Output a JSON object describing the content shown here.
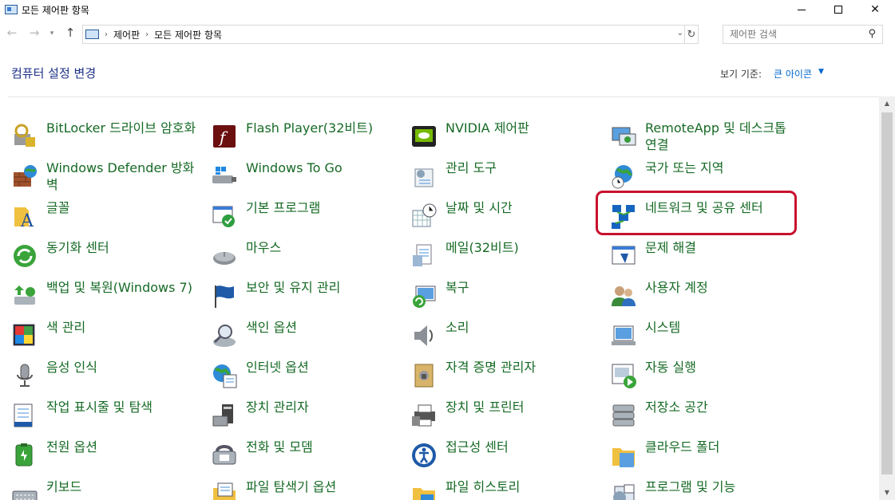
{
  "window": {
    "title": "모든 제어판 항목"
  },
  "address": {
    "crumbs": [
      "제어판",
      "모든 제어판 항목"
    ],
    "search_placeholder": "제어판 검색"
  },
  "header": {
    "title": "컴퓨터 설정 변경",
    "view_by_label": "보기 기준:",
    "view_by_value": "큰 아이콘"
  },
  "items": [
    {
      "label": "BitLocker 드라이브 암호화",
      "icon": "bitlocker-icon"
    },
    {
      "label": "Flash Player(32비트)",
      "icon": "flash-player-icon"
    },
    {
      "label": "NVIDIA 제어판",
      "icon": "nvidia-icon"
    },
    {
      "label": "RemoteApp 및 데스크톱 연결",
      "icon": "remoteapp-icon"
    },
    {
      "label": "Windows Defender 방화벽",
      "icon": "firewall-icon"
    },
    {
      "label": "Windows To Go",
      "icon": "windows-to-go-icon"
    },
    {
      "label": "관리 도구",
      "icon": "admin-tools-icon"
    },
    {
      "label": "국가 또는 지역",
      "icon": "region-icon"
    },
    {
      "label": "글꼴",
      "icon": "fonts-icon"
    },
    {
      "label": "기본 프로그램",
      "icon": "default-programs-icon"
    },
    {
      "label": "날짜 및 시간",
      "icon": "date-time-icon"
    },
    {
      "label": "네트워크 및 공유 센터",
      "icon": "network-icon"
    },
    {
      "label": "동기화 센터",
      "icon": "sync-center-icon"
    },
    {
      "label": "마우스",
      "icon": "mouse-icon"
    },
    {
      "label": "메일(32비트)",
      "icon": "mail-icon"
    },
    {
      "label": "문제 해결",
      "icon": "troubleshooting-icon"
    },
    {
      "label": "백업 및 복원(Windows 7)",
      "icon": "backup-icon"
    },
    {
      "label": "보안 및 유지 관리",
      "icon": "security-flag-icon"
    },
    {
      "label": "복구",
      "icon": "recovery-icon"
    },
    {
      "label": "사용자 계정",
      "icon": "user-accounts-icon"
    },
    {
      "label": "색 관리",
      "icon": "color-management-icon"
    },
    {
      "label": "색인 옵션",
      "icon": "indexing-icon"
    },
    {
      "label": "소리",
      "icon": "sound-icon"
    },
    {
      "label": "시스템",
      "icon": "system-icon"
    },
    {
      "label": "음성 인식",
      "icon": "microphone-icon"
    },
    {
      "label": "인터넷 옵션",
      "icon": "internet-options-icon"
    },
    {
      "label": "자격 증명 관리자",
      "icon": "credential-icon"
    },
    {
      "label": "자동 실행",
      "icon": "autoplay-icon"
    },
    {
      "label": "작업 표시줄 및 탐색",
      "icon": "taskbar-icon"
    },
    {
      "label": "장치 관리자",
      "icon": "device-manager-icon"
    },
    {
      "label": "장치 및 프린터",
      "icon": "printer-icon"
    },
    {
      "label": "저장소 공간",
      "icon": "storage-icon"
    },
    {
      "label": "전원 옵션",
      "icon": "power-icon"
    },
    {
      "label": "전화 및 모뎀",
      "icon": "phone-icon"
    },
    {
      "label": "접근성 센터",
      "icon": "ease-of-access-icon"
    },
    {
      "label": "클라우드 폴더",
      "icon": "work-folders-icon"
    },
    {
      "label": "키보드",
      "icon": "keyboard-icon"
    },
    {
      "label": "파일 탐색기 옵션",
      "icon": "folder-options-icon"
    },
    {
      "label": "파일 히스토리",
      "icon": "file-history-icon"
    },
    {
      "label": "프로그램 및 기능",
      "icon": "programs-icon"
    }
  ]
}
